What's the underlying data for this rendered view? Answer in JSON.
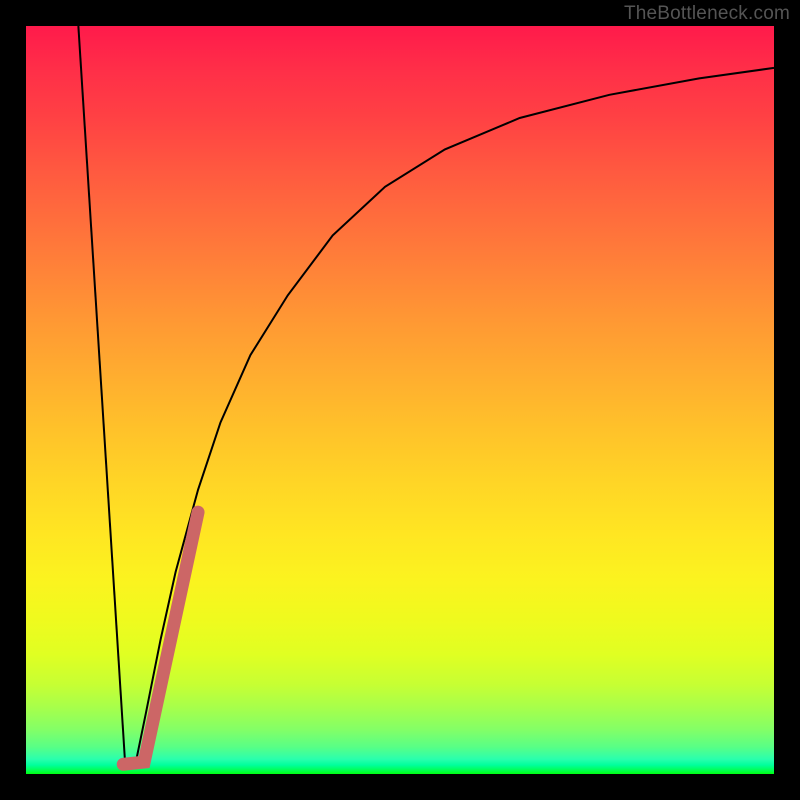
{
  "watermark": "TheBottleneck.com",
  "chart_data": {
    "type": "line",
    "title": "",
    "xlabel": "",
    "ylabel": "",
    "xlim": [
      0,
      100
    ],
    "ylim": [
      0,
      100
    ],
    "grid": false,
    "series": [
      {
        "name": "left-descent",
        "color": "#000000",
        "width": 2,
        "x": [
          7.0,
          13.3
        ],
        "y": [
          100,
          0.7
        ]
      },
      {
        "name": "right-curve",
        "color": "#000000",
        "width": 2,
        "x": [
          14.5,
          16,
          18,
          20,
          23,
          26,
          30,
          35,
          41,
          48,
          56,
          66,
          78,
          90,
          100
        ],
        "y": [
          0.7,
          8,
          18,
          27,
          38,
          47,
          56,
          64,
          72,
          78.5,
          83.5,
          87.7,
          90.8,
          93.0,
          94.4
        ]
      },
      {
        "name": "highlight-segment",
        "color": "#cc6666",
        "width": 13,
        "linecap": "round",
        "x": [
          13.0,
          15.8,
          20.2,
          23.0
        ],
        "y": [
          1.3,
          1.6,
          22.0,
          35.0
        ]
      }
    ],
    "background_gradient": {
      "top": "#ff1a4b",
      "mid": "#ffd21f",
      "bottom": "#00ff30"
    }
  }
}
